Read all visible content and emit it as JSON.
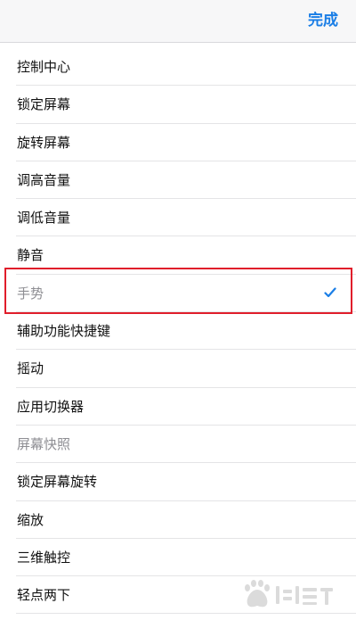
{
  "header": {
    "done_label": "完成"
  },
  "list": {
    "items": [
      {
        "label": "控制中心",
        "enabled": true,
        "checked": false
      },
      {
        "label": "锁定屏幕",
        "enabled": true,
        "checked": false
      },
      {
        "label": "旋转屏幕",
        "enabled": true,
        "checked": false
      },
      {
        "label": "调高音量",
        "enabled": true,
        "checked": false
      },
      {
        "label": "调低音量",
        "enabled": true,
        "checked": false
      },
      {
        "label": "静音",
        "enabled": true,
        "checked": false
      },
      {
        "label": "手势",
        "enabled": false,
        "checked": true
      },
      {
        "label": "辅助功能快捷键",
        "enabled": true,
        "checked": false
      },
      {
        "label": "摇动",
        "enabled": true,
        "checked": false
      },
      {
        "label": "应用切换器",
        "enabled": true,
        "checked": false
      },
      {
        "label": "屏幕快照",
        "enabled": false,
        "checked": false
      },
      {
        "label": "锁定屏幕旋转",
        "enabled": true,
        "checked": false
      },
      {
        "label": "缩放",
        "enabled": true,
        "checked": false
      },
      {
        "label": "三维触控",
        "enabled": true,
        "checked": false
      },
      {
        "label": "轻点两下",
        "enabled": true,
        "checked": false
      }
    ]
  },
  "colors": {
    "accent": "#1a7ee6",
    "highlight": "#e01e2b",
    "disabled_text": "#8e8e93"
  },
  "icons": {
    "checkmark": "checkmark-icon",
    "watermark": "baidu-jingyan-watermark-logo"
  }
}
